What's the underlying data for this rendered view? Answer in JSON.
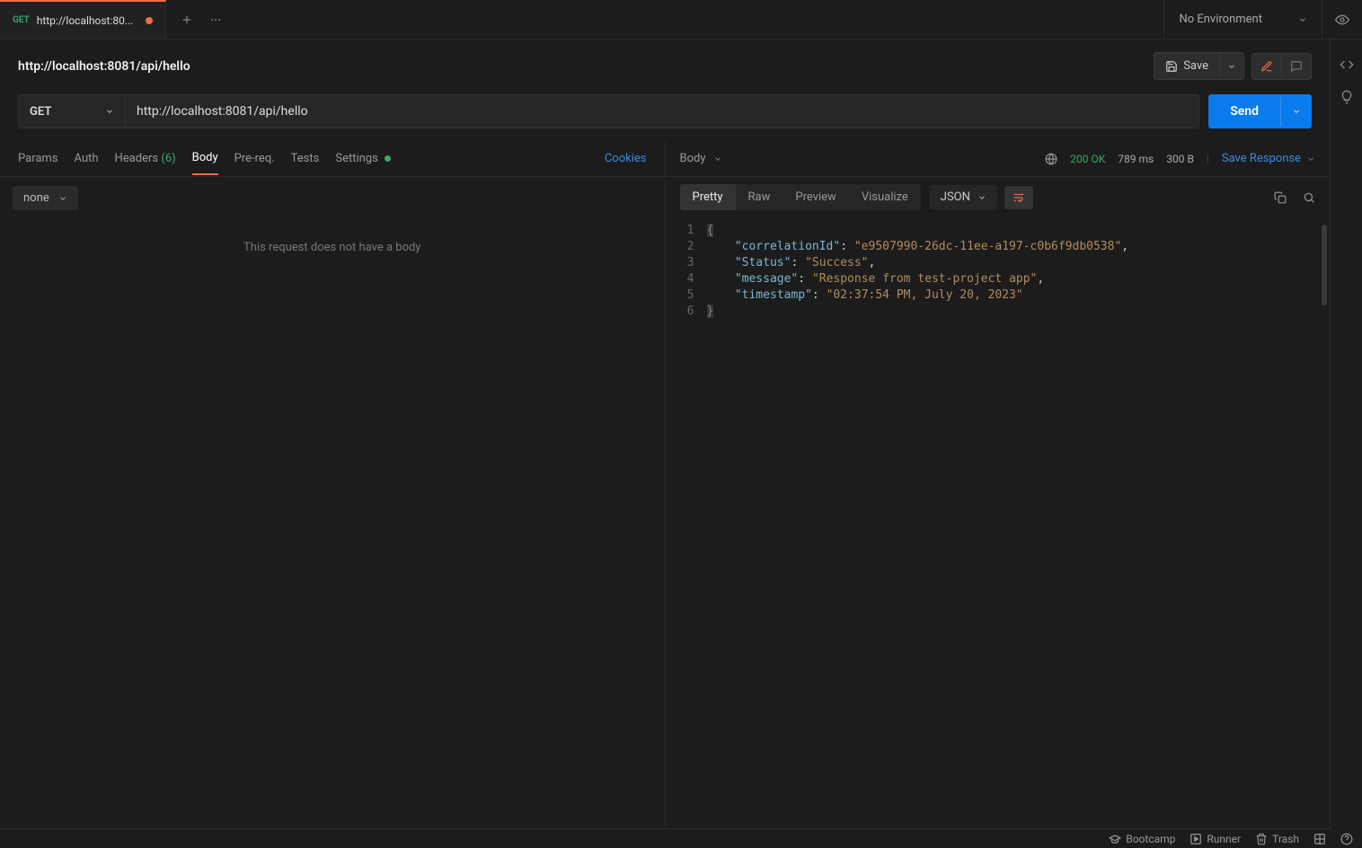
{
  "tab": {
    "method": "GET",
    "title": "http://localhost:80..."
  },
  "env": {
    "label": "No Environment"
  },
  "request": {
    "title": "http://localhost:8081/api/hello",
    "method": "GET",
    "url": "http://localhost:8081/api/hello",
    "save_label": "Save",
    "send_label": "Send"
  },
  "req_tabs": {
    "params": "Params",
    "auth": "Auth",
    "headers": "Headers",
    "headers_count": "(6)",
    "body": "Body",
    "prereq": "Pre-req.",
    "tests": "Tests",
    "settings": "Settings",
    "cookies": "Cookies"
  },
  "body_none": "none",
  "empty_body_msg": "This request does not have a body",
  "response": {
    "body_label": "Body",
    "status": "200 OK",
    "time": "789 ms",
    "size": "300 B",
    "save_label": "Save Response",
    "views": {
      "pretty": "Pretty",
      "raw": "Raw",
      "preview": "Preview",
      "visualize": "Visualize"
    },
    "format": "JSON",
    "lines": [
      "1",
      "2",
      "3",
      "4",
      "5",
      "6"
    ],
    "json": {
      "k1": "\"correlationId\"",
      "v1": "\"e9507990-26dc-11ee-a197-c0b6f9db0538\"",
      "k2": "\"Status\"",
      "v2": "\"Success\"",
      "k3": "\"message\"",
      "v3": "\"Response from test-project app\"",
      "k4": "\"timestamp\"",
      "v4": "\"02:37:54 PM, July 20, 2023\""
    }
  },
  "statusbar": {
    "bootcamp": "Bootcamp",
    "runner": "Runner",
    "trash": "Trash"
  }
}
